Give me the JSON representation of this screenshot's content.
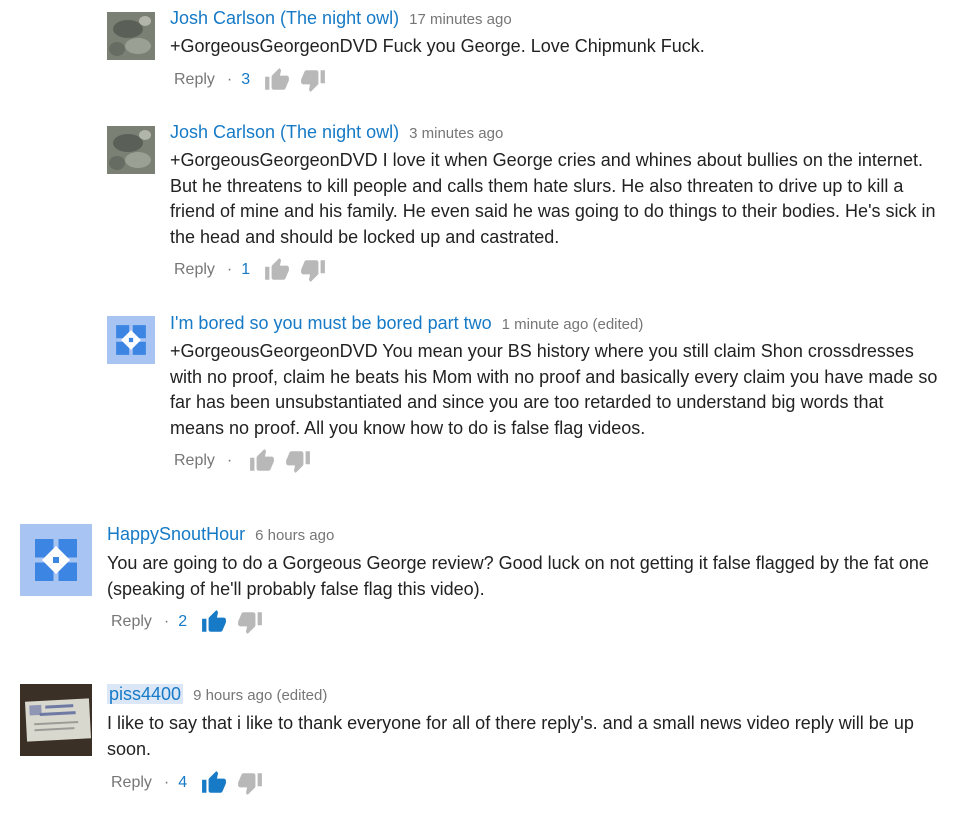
{
  "icons": {
    "like": "thumbs-up-icon",
    "dislike": "thumbs-down-icon"
  },
  "colors": {
    "author": "#167ac6",
    "meta": "#767676",
    "like_active": "#167ac6",
    "like_inactive": "#b8b8b8"
  },
  "comments": [
    {
      "author": "Josh Carlson (The night owl)",
      "time": "17 minutes ago",
      "text": "+GorgeousGeorgeonDVD Fuck you George. Love Chipmunk Fuck.",
      "reply_label": "Reply",
      "separator": "·",
      "likes": "3",
      "avatar": "photo-avatar"
    },
    {
      "author": "Josh Carlson (The night owl)",
      "time": "3 minutes ago",
      "text": "+GorgeousGeorgeonDVD I love it when George cries and whines about bullies on the internet. But he threatens to kill people and calls them hate slurs. He also threaten to drive up to kill a friend of mine and his family. He even said he was going to do things to their bodies. He's sick in the head and should be locked up and castrated.",
      "reply_label": "Reply",
      "separator": "·",
      "likes": "1",
      "avatar": "photo-avatar"
    },
    {
      "author": "I'm bored so you must be bored part two",
      "time": "1 minute ago (edited)",
      "text": "+GorgeousGeorgeonDVD You mean your BS history where you still claim Shon crossdresses with no proof, claim he beats his Mom with no proof and basically every claim you have made so far has been unsubstantiated and since you are too retarded to understand big words that means no proof.  All you know how to do is false flag videos.",
      "reply_label": "Reply",
      "separator": "·",
      "likes": "",
      "avatar": "default-avatar"
    },
    {
      "author": "HappySnoutHour",
      "time": "6 hours ago",
      "text": "You are going to do a Gorgeous George review? Good luck on not getting it false flagged by the fat one (speaking of he'll probably false flag this video).",
      "reply_label": "Reply",
      "separator": "·",
      "likes": "2",
      "avatar": "default-avatar"
    },
    {
      "author": "piss4400",
      "time": "9 hours ago (edited)",
      "text": "I like to say that i like to thank everyone  for all of there reply's. and a small news video reply will be up soon.",
      "reply_label": "Reply",
      "separator": "·",
      "likes": "4",
      "avatar": "photo-avatar"
    }
  ]
}
